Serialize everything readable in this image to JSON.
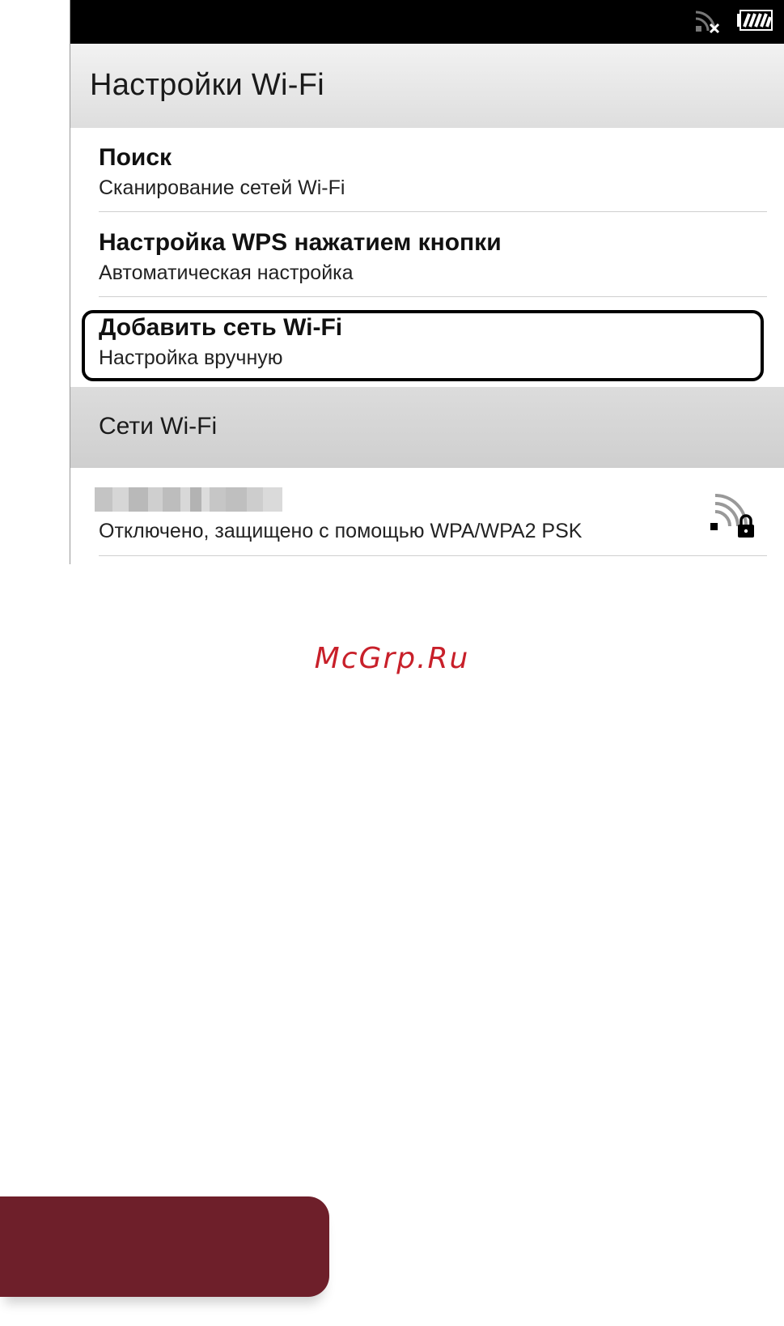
{
  "status_bar": {
    "wifi_icon": "wifi-disconnected-icon",
    "battery_icon": "battery-full-icon"
  },
  "header": {
    "title": "Настройки Wi-Fi"
  },
  "menu": {
    "items": [
      {
        "title": "Поиск",
        "subtitle": "Сканирование сетей Wi-Fi"
      },
      {
        "title": "Настройка WPS нажатием кнопки",
        "subtitle": "Автоматическая настройка"
      },
      {
        "title": "Добавить сеть Wi-Fi",
        "subtitle": "Настройка вручную",
        "highlighted": true
      }
    ]
  },
  "networks_section": {
    "label": "Сети Wi-Fi",
    "networks": [
      {
        "name": "",
        "name_obscured": true,
        "status": "Отключено, защищено с помощью WPA/WPA2 PSK",
        "icon": "wifi-secured-lock-icon"
      }
    ]
  },
  "watermark": {
    "text": "McGrp.Ru"
  },
  "colors": {
    "status_bar": "#000000",
    "section_header": "#d5d5d5",
    "watermark": "#c8202a",
    "footer_block": "#6e1f2a"
  }
}
